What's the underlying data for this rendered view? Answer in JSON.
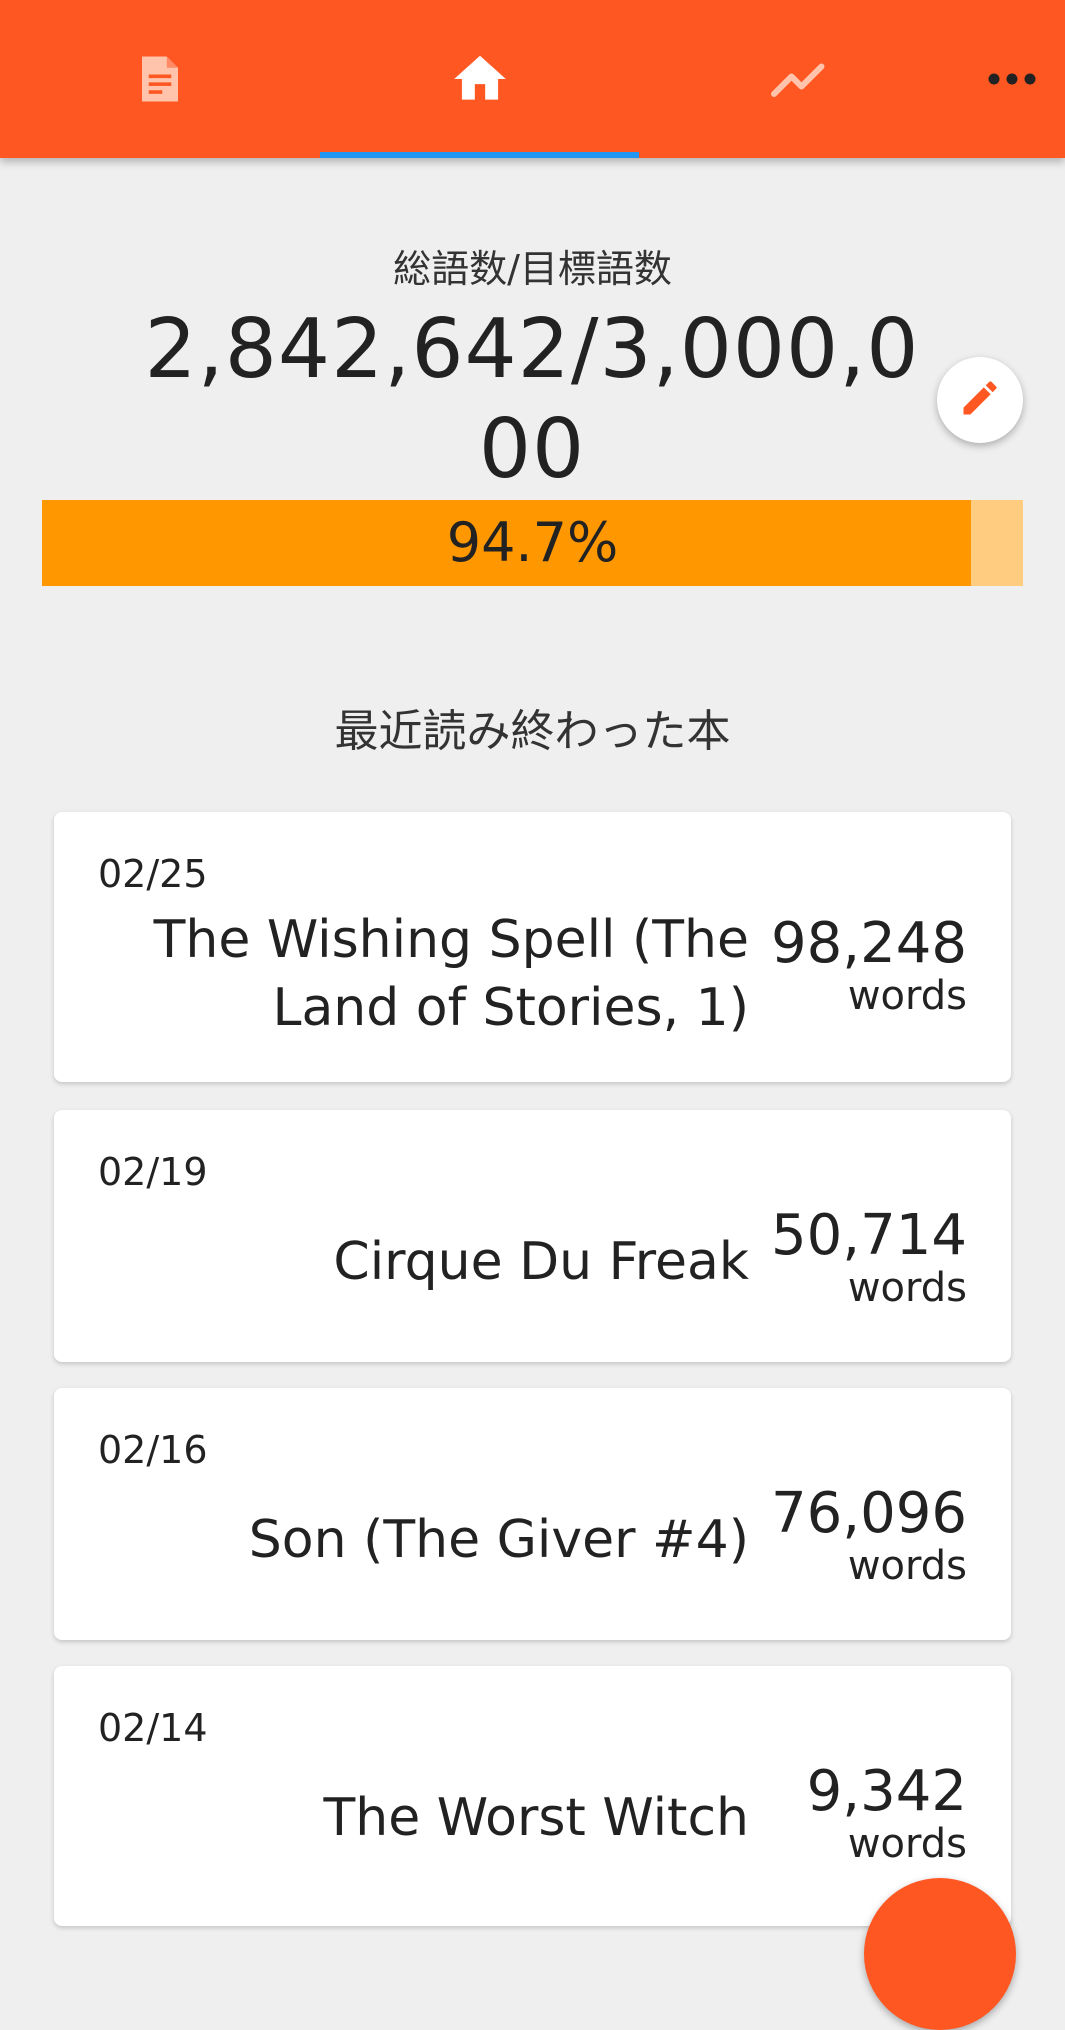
{
  "colors": {
    "app_bar": "#ff5722",
    "tab_indicator": "#2196f3",
    "progress_fill": "#ff9800",
    "progress_track": "#ffcc80",
    "fab": "#ff5722",
    "background": "#efefef"
  },
  "tabs": [
    {
      "icon": "document-icon",
      "selected": false
    },
    {
      "icon": "home-icon",
      "selected": true
    },
    {
      "icon": "trending-line-icon",
      "selected": false
    },
    {
      "icon": "more-dots-icon",
      "selected": false
    }
  ],
  "goal": {
    "title": "総語数/目標語数",
    "value": "2,842,642/3,000,000",
    "edit_icon": "pencil-icon",
    "progress_fraction": 0.947,
    "progress_label": "94.7%"
  },
  "recent": {
    "title": "最近読み終わった本",
    "books": [
      {
        "date": "02/25",
        "title": "The Wishing Spell (The Land of Stories, 1)",
        "count": "98,248",
        "unit": "words"
      },
      {
        "date": "02/19",
        "title": "Cirque Du Freak",
        "count": "50,714",
        "unit": "words"
      },
      {
        "date": "02/16",
        "title": "Son (The Giver #4)",
        "count": "76,096",
        "unit": "words"
      },
      {
        "date": "02/14",
        "title": "The Worst Witch",
        "count": "9,342",
        "unit": "words"
      }
    ]
  }
}
